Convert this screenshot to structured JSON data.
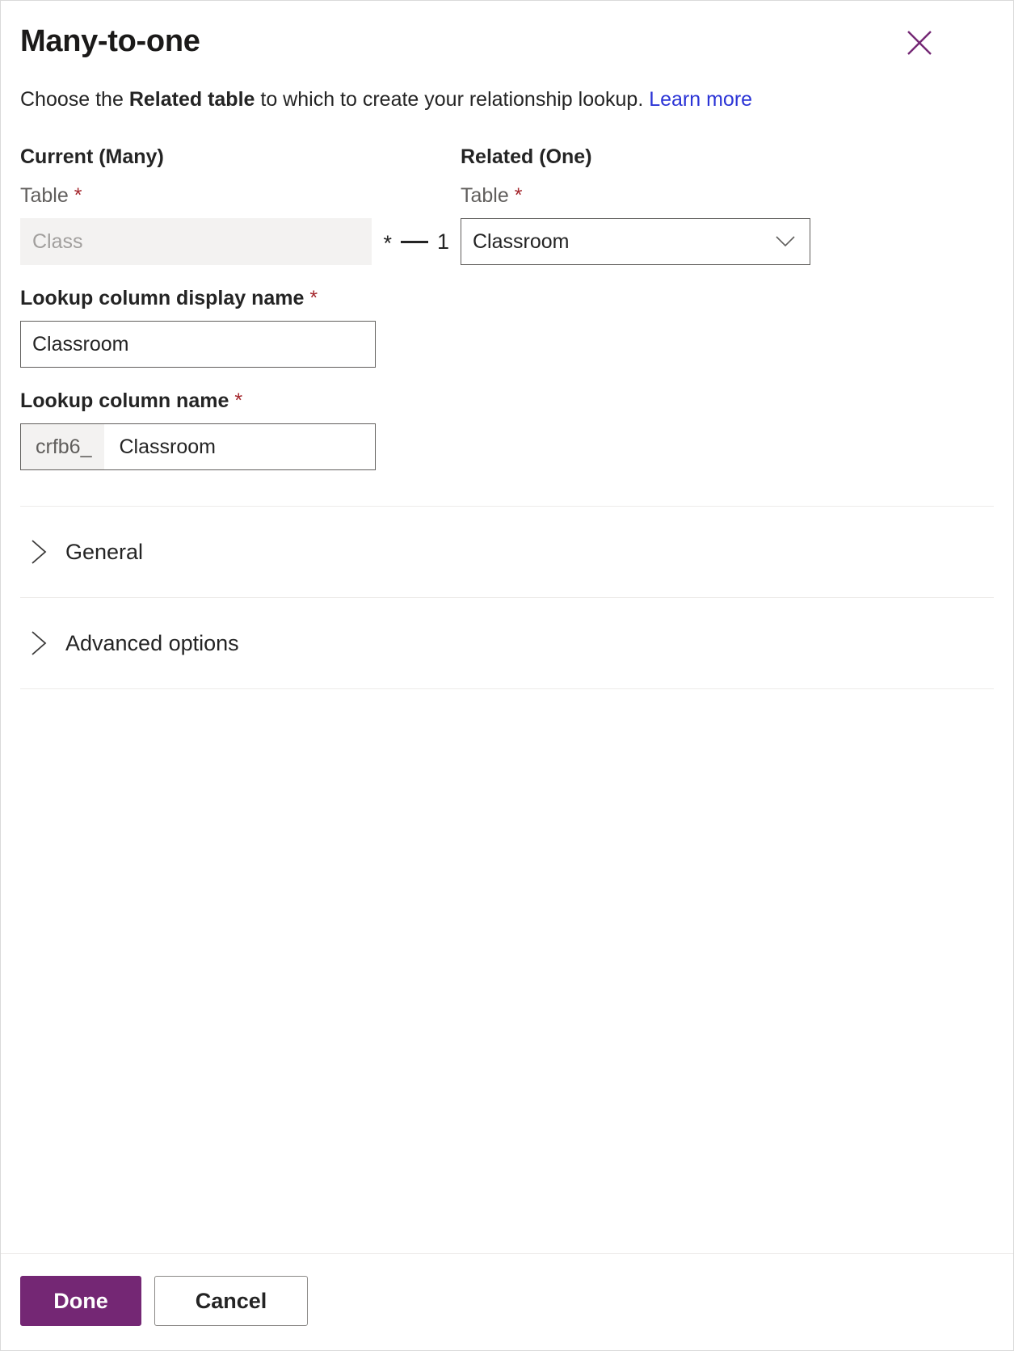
{
  "dialog": {
    "title": "Many-to-one",
    "close_icon": "close-icon",
    "description": {
      "prefix": "Choose the ",
      "emphasis": "Related table",
      "suffix": " to which to create your relationship lookup. ",
      "link": "Learn more"
    }
  },
  "current": {
    "heading": "Current (Many)",
    "table_label": "Table",
    "required_marker": "*",
    "table_value": "Class"
  },
  "cardinality": {
    "many": "*",
    "separator": "—",
    "one": "1"
  },
  "related": {
    "heading": "Related (One)",
    "table_label": "Table",
    "required_marker": "*",
    "table_value": "Classroom",
    "dropdown_icon": "chevron-down-icon"
  },
  "lookup_display_name": {
    "label": "Lookup column display name",
    "required_marker": "*",
    "value": "Classroom"
  },
  "lookup_name": {
    "label": "Lookup column name",
    "required_marker": "*",
    "prefix": "crfb6_",
    "value": "Classroom"
  },
  "sections": [
    {
      "label": "General",
      "icon": "chevron-right-icon"
    },
    {
      "label": "Advanced options",
      "icon": "chevron-right-icon"
    }
  ],
  "footer": {
    "done_label": "Done",
    "cancel_label": "Cancel"
  },
  "colors": {
    "primary": "#742774",
    "link": "#2b34d6",
    "required": "#a4262c",
    "border": "#605e5c",
    "disabled_bg": "#f3f2f1"
  }
}
